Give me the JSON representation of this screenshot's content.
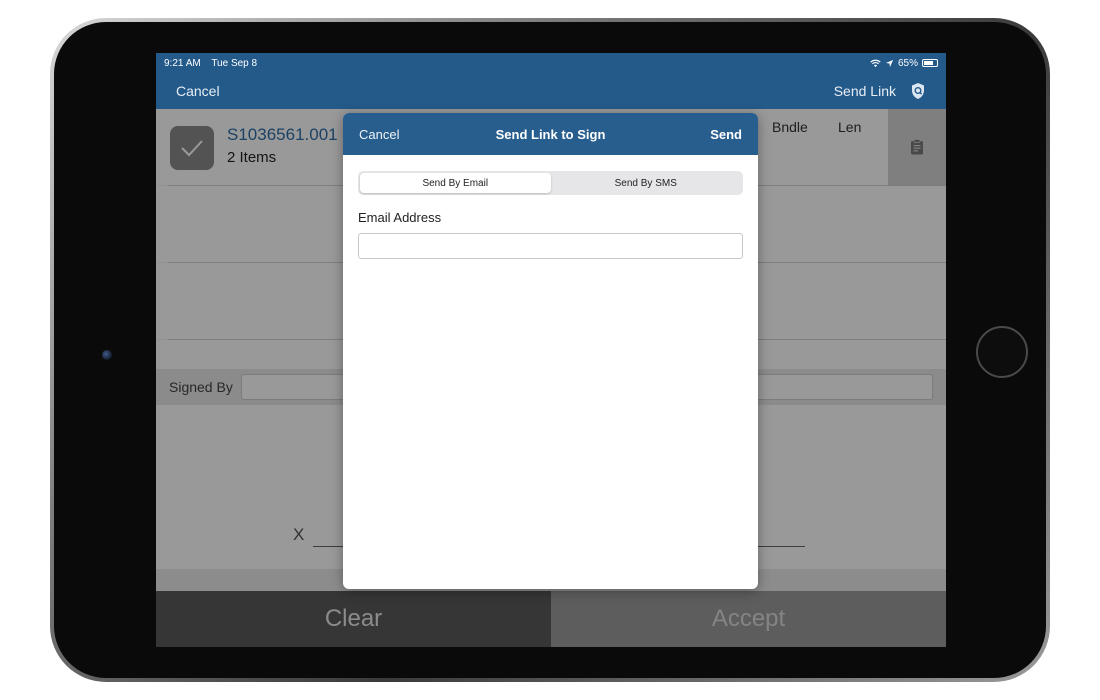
{
  "status_bar": {
    "time": "9:21 AM",
    "date": "Tue Sep 8",
    "battery": "65%"
  },
  "nav": {
    "cancel_label": "Cancel",
    "send_link_label": "Send Link"
  },
  "order": {
    "id": "S1036561.001",
    "items": "2 Items",
    "columns": [
      "Bndle",
      "Len"
    ]
  },
  "signature": {
    "signed_by_label": "Signed By",
    "x_mark": "X"
  },
  "actions": {
    "clear_label": "Clear",
    "accept_label": "Accept"
  },
  "modal": {
    "cancel_label": "Cancel",
    "title": "Send Link to Sign",
    "send_label": "Send",
    "tabs": [
      {
        "label": "Send By Email",
        "active": true
      },
      {
        "label": "Send By SMS",
        "active": false
      }
    ],
    "email_label": "Email Address",
    "email_value": ""
  },
  "colors": {
    "brand_blue": "#245a8a",
    "link_blue": "#2d6ea8"
  }
}
